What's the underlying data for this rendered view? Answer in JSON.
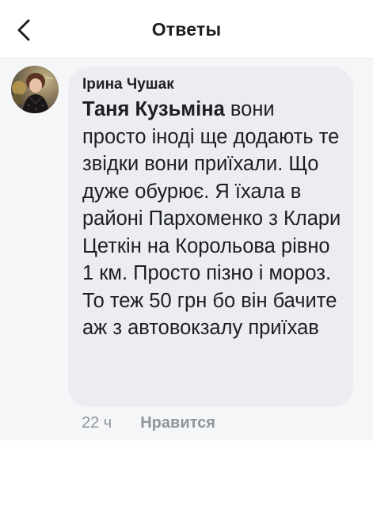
{
  "header": {
    "title": "Ответы",
    "back_icon": "chevron-left-icon"
  },
  "comment": {
    "author": "Ірина Чушак",
    "mention": "Таня Кузьміна",
    "text": "вони просто іноді ще додають те звідки вони приїхали. Що дуже обурює. Я їхала в районі Пархоменко з Клари Цеткін на Корольова рівно 1 км. Просто пізно і мороз. То теж 50 грн бо він бачите аж з автовокзалу приїхав",
    "time": "22 ч",
    "like_label": "Нравится"
  },
  "colors": {
    "bubble": "#ebedf0",
    "thread_background": "#f5f6f8",
    "text": "#1c1e21",
    "meta_text": "#90949c"
  }
}
